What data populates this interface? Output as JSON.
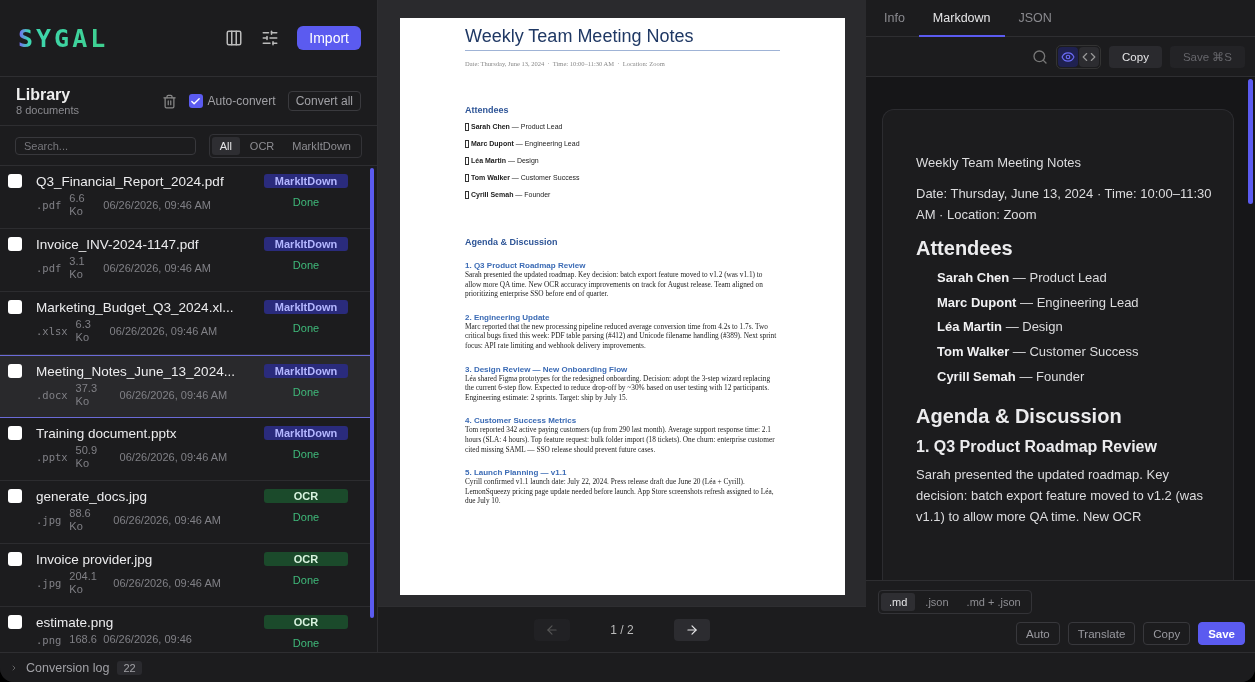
{
  "header": {
    "logo": "SYGAL",
    "import_button": "Import"
  },
  "library": {
    "title": "Library",
    "count": "8 documents",
    "auto_convert": {
      "label": "Auto-convert",
      "checked": true
    },
    "convert_all": "Convert all",
    "search": {
      "placeholder": "Search..."
    },
    "filters": [
      {
        "label": "All",
        "selected": true
      },
      {
        "label": "OCR",
        "selected": false
      },
      {
        "label": "MarkItDown",
        "selected": false
      }
    ],
    "files": [
      {
        "name": "Q3_Financial_Report_2024.pdf",
        "ext": ".pdf",
        "size": "6.6 Ko",
        "date": "06/26/2026, 09:46 AM",
        "engine": {
          "kind": "markitdown",
          "label": "MarkItDown"
        },
        "status": "Done",
        "checked": false,
        "selected": false
      },
      {
        "name": "Invoice_INV-2024-1147.pdf",
        "ext": ".pdf",
        "size": "3.1 Ko",
        "date": "06/26/2026, 09:46 AM",
        "engine": {
          "kind": "markitdown",
          "label": "MarkItDown"
        },
        "status": "Done",
        "checked": false,
        "selected": false
      },
      {
        "name": "Marketing_Budget_Q3_2024.xl...",
        "ext": ".xlsx",
        "size": "6.3 Ko",
        "date": "06/26/2026, 09:46 AM",
        "engine": {
          "kind": "markitdown",
          "label": "MarkItDown"
        },
        "status": "Done",
        "checked": false,
        "selected": false
      },
      {
        "name": "Meeting_Notes_June_13_2024...",
        "ext": ".docx",
        "size": "37.3 Ko",
        "date": "06/26/2026, 09:46 AM",
        "engine": {
          "kind": "markitdown",
          "label": "MarkItDown"
        },
        "status": "Done",
        "checked": false,
        "selected": true
      },
      {
        "name": "Training document.pptx",
        "ext": ".pptx",
        "size": "50.9 Ko",
        "date": "06/26/2026, 09:46 AM",
        "engine": {
          "kind": "markitdown",
          "label": "MarkItDown"
        },
        "status": "Done",
        "checked": false,
        "selected": false
      },
      {
        "name": "generate_docs.jpg",
        "ext": ".jpg",
        "size": "88.6 Ko",
        "date": "06/26/2026, 09:46 AM",
        "engine": {
          "kind": "ocr",
          "label": "OCR"
        },
        "status": "Done",
        "checked": false,
        "selected": false
      },
      {
        "name": "Invoice provider.jpg",
        "ext": ".jpg",
        "size": "204.1 Ko",
        "date": "06/26/2026, 09:46 AM",
        "engine": {
          "kind": "ocr",
          "label": "OCR"
        },
        "status": "Done",
        "checked": false,
        "selected": false
      },
      {
        "name": "estimate.png",
        "ext": ".png",
        "size": "168.6",
        "date": "06/26/2026, 09:46",
        "engine": {
          "kind": "ocr",
          "label": "OCR"
        },
        "status": "Done",
        "checked": false,
        "selected": false
      }
    ]
  },
  "preview": {
    "page": {
      "title": "Weekly Team Meeting Notes",
      "meta": "Date: Thursday, June 13, 2024  ·  Time: 10:00–11:30 AM  ·  Location: Zoom",
      "blocks": [
        {
          "kind": "heading",
          "text": "Attendees"
        },
        {
          "kind": "attendee",
          "text": "**Sarah Chen** — Product Lead"
        },
        {
          "kind": "attendee",
          "text": "**Marc Dupont** — Engineering Lead"
        },
        {
          "kind": "attendee",
          "text": "**Léa Martin** — Design"
        },
        {
          "kind": "attendee",
          "text": "**Tom Walker** — Customer Success"
        },
        {
          "kind": "attendee",
          "text": "**Cyrill Semah** — Founder"
        },
        {
          "kind": "heading",
          "text": "Agenda & Discussion"
        },
        {
          "kind": "subheading",
          "text": "1. Q3 Product Roadmap Review"
        },
        {
          "kind": "paragraph",
          "text": "Sarah presented the updated roadmap. Key decision: batch export feature moved to v1.2 (was v1.1) to allow more QA time. New OCR accuracy improvements on track for August release. Team aligned on prioritizing enterprise SSO before end of quarter."
        },
        {
          "kind": "subheading",
          "text": "2. Engineering Update"
        },
        {
          "kind": "paragraph",
          "text": "Marc reported that the new processing pipeline reduced average conversion time from 4.2s to 1.7s. Two critical bugs fixed this week: PDF table parsing (#412) and Unicode filename handling (#389). Next sprint focus: API rate limiting and webhook delivery improvements."
        },
        {
          "kind": "subheading",
          "text": "3. Design Review — New Onboarding Flow"
        },
        {
          "kind": "paragraph",
          "text": "Léa shared Figma prototypes for the redesigned onboarding. Decision: adopt the 3-step wizard replacing the current 6-step flow. Expected to reduce drop-off by ~30% based on user testing with 12 participants. Engineering estimate: 2 sprints. Target: ship by July 15."
        },
        {
          "kind": "subheading",
          "text": "4. Customer Success Metrics"
        },
        {
          "kind": "paragraph",
          "text": "Tom reported 342 active paying customers (up from 290 last month). Average support response time: 2.1 hours (SLA: 4 hours). Top feature request: bulk folder import (18 tickets). One churn: enterprise customer cited missing SAML — SSO release should prevent future cases."
        },
        {
          "kind": "subheading",
          "text": "5. Launch Planning — v1.1"
        },
        {
          "kind": "paragraph",
          "text": "Cyrill confirmed v1.1 launch date: July 22, 2024. Press release draft due June 20 (Léa + Cyrill). LemonSqueezy pricing page update needed before launch. App Store screenshots refresh assigned to Léa, due July 10."
        }
      ]
    },
    "pager": {
      "label": "1 / 2",
      "prev_disabled": true,
      "next_disabled": false
    }
  },
  "inspector": {
    "tabs": [
      {
        "label": "Info",
        "selected": false
      },
      {
        "label": "Markdown",
        "selected": true
      },
      {
        "label": "JSON",
        "selected": false
      }
    ],
    "view_modes": [
      {
        "kind": "preview",
        "selected": true
      },
      {
        "kind": "source",
        "selected": false
      }
    ],
    "copy_button": "Copy",
    "save_button": {
      "label": "Save ⌘S",
      "disabled": true
    },
    "markdown": [
      {
        "kind": "p",
        "text": "Weekly Team Meeting Notes"
      },
      {
        "kind": "p",
        "text": "Date: Thursday, June 13, 2024 · Time: 10:00–11:30 AM · Location: Zoom"
      },
      {
        "kind": "h2",
        "text": "Attendees"
      },
      {
        "kind": "li",
        "text": "**Sarah Chen** — Product Lead"
      },
      {
        "kind": "li",
        "text": "**Marc Dupont** — Engineering Lead"
      },
      {
        "kind": "li",
        "text": "**Léa Martin** — Design"
      },
      {
        "kind": "li",
        "text": "**Tom Walker** — Customer Success"
      },
      {
        "kind": "li",
        "text": "**Cyrill Semah** — Founder"
      },
      {
        "kind": "h2",
        "text": "Agenda & Discussion"
      },
      {
        "kind": "h3",
        "text": "1. Q3 Product Roadmap Review"
      },
      {
        "kind": "p",
        "text": "Sarah presented the updated roadmap. Key decision: batch export feature moved to v1.2 (was v1.1) to allow more QA time. New OCR"
      }
    ],
    "formats": [
      {
        "label": ".md",
        "selected": true
      },
      {
        "label": ".json",
        "selected": false
      },
      {
        "label": ".md + .json",
        "selected": false
      }
    ],
    "actions": [
      {
        "label": "Auto",
        "kind": "secondary"
      },
      {
        "label": "Translate",
        "kind": "secondary"
      },
      {
        "label": "Copy",
        "kind": "secondary"
      },
      {
        "label": "Save",
        "kind": "primary"
      }
    ]
  },
  "status_bar": {
    "label": "Conversion log",
    "count": "22"
  }
}
